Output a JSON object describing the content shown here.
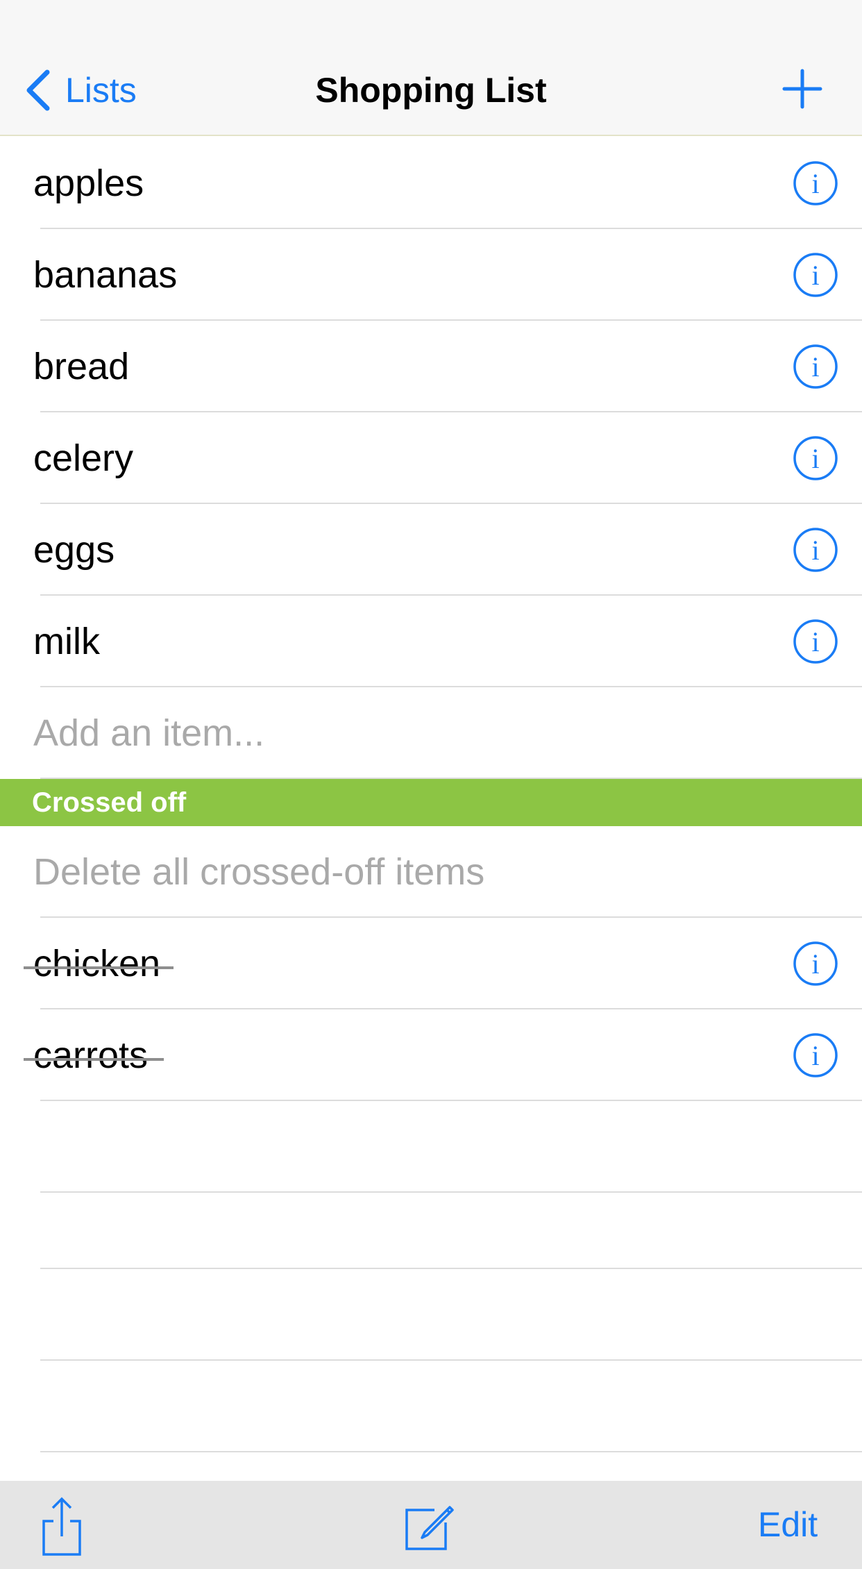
{
  "colors": {
    "accent": "#1a7cf5",
    "section_header": "#8cc544",
    "placeholder": "#a9a9a9"
  },
  "navbar": {
    "back_label": "Lists",
    "title": "Shopping List",
    "add_icon": "plus-icon"
  },
  "items": [
    {
      "label": "apples"
    },
    {
      "label": "bananas"
    },
    {
      "label": "bread"
    },
    {
      "label": "celery"
    },
    {
      "label": "eggs"
    },
    {
      "label": "milk"
    }
  ],
  "add_item": {
    "placeholder": "Add an item..."
  },
  "crossed_section": {
    "header": "Crossed off",
    "delete_all_label": "Delete all crossed-off items",
    "items": [
      {
        "label": "chicken"
      },
      {
        "label": "carrots"
      }
    ]
  },
  "toolbar": {
    "share_icon": "share-icon",
    "compose_icon": "compose-icon",
    "edit_label": "Edit"
  }
}
